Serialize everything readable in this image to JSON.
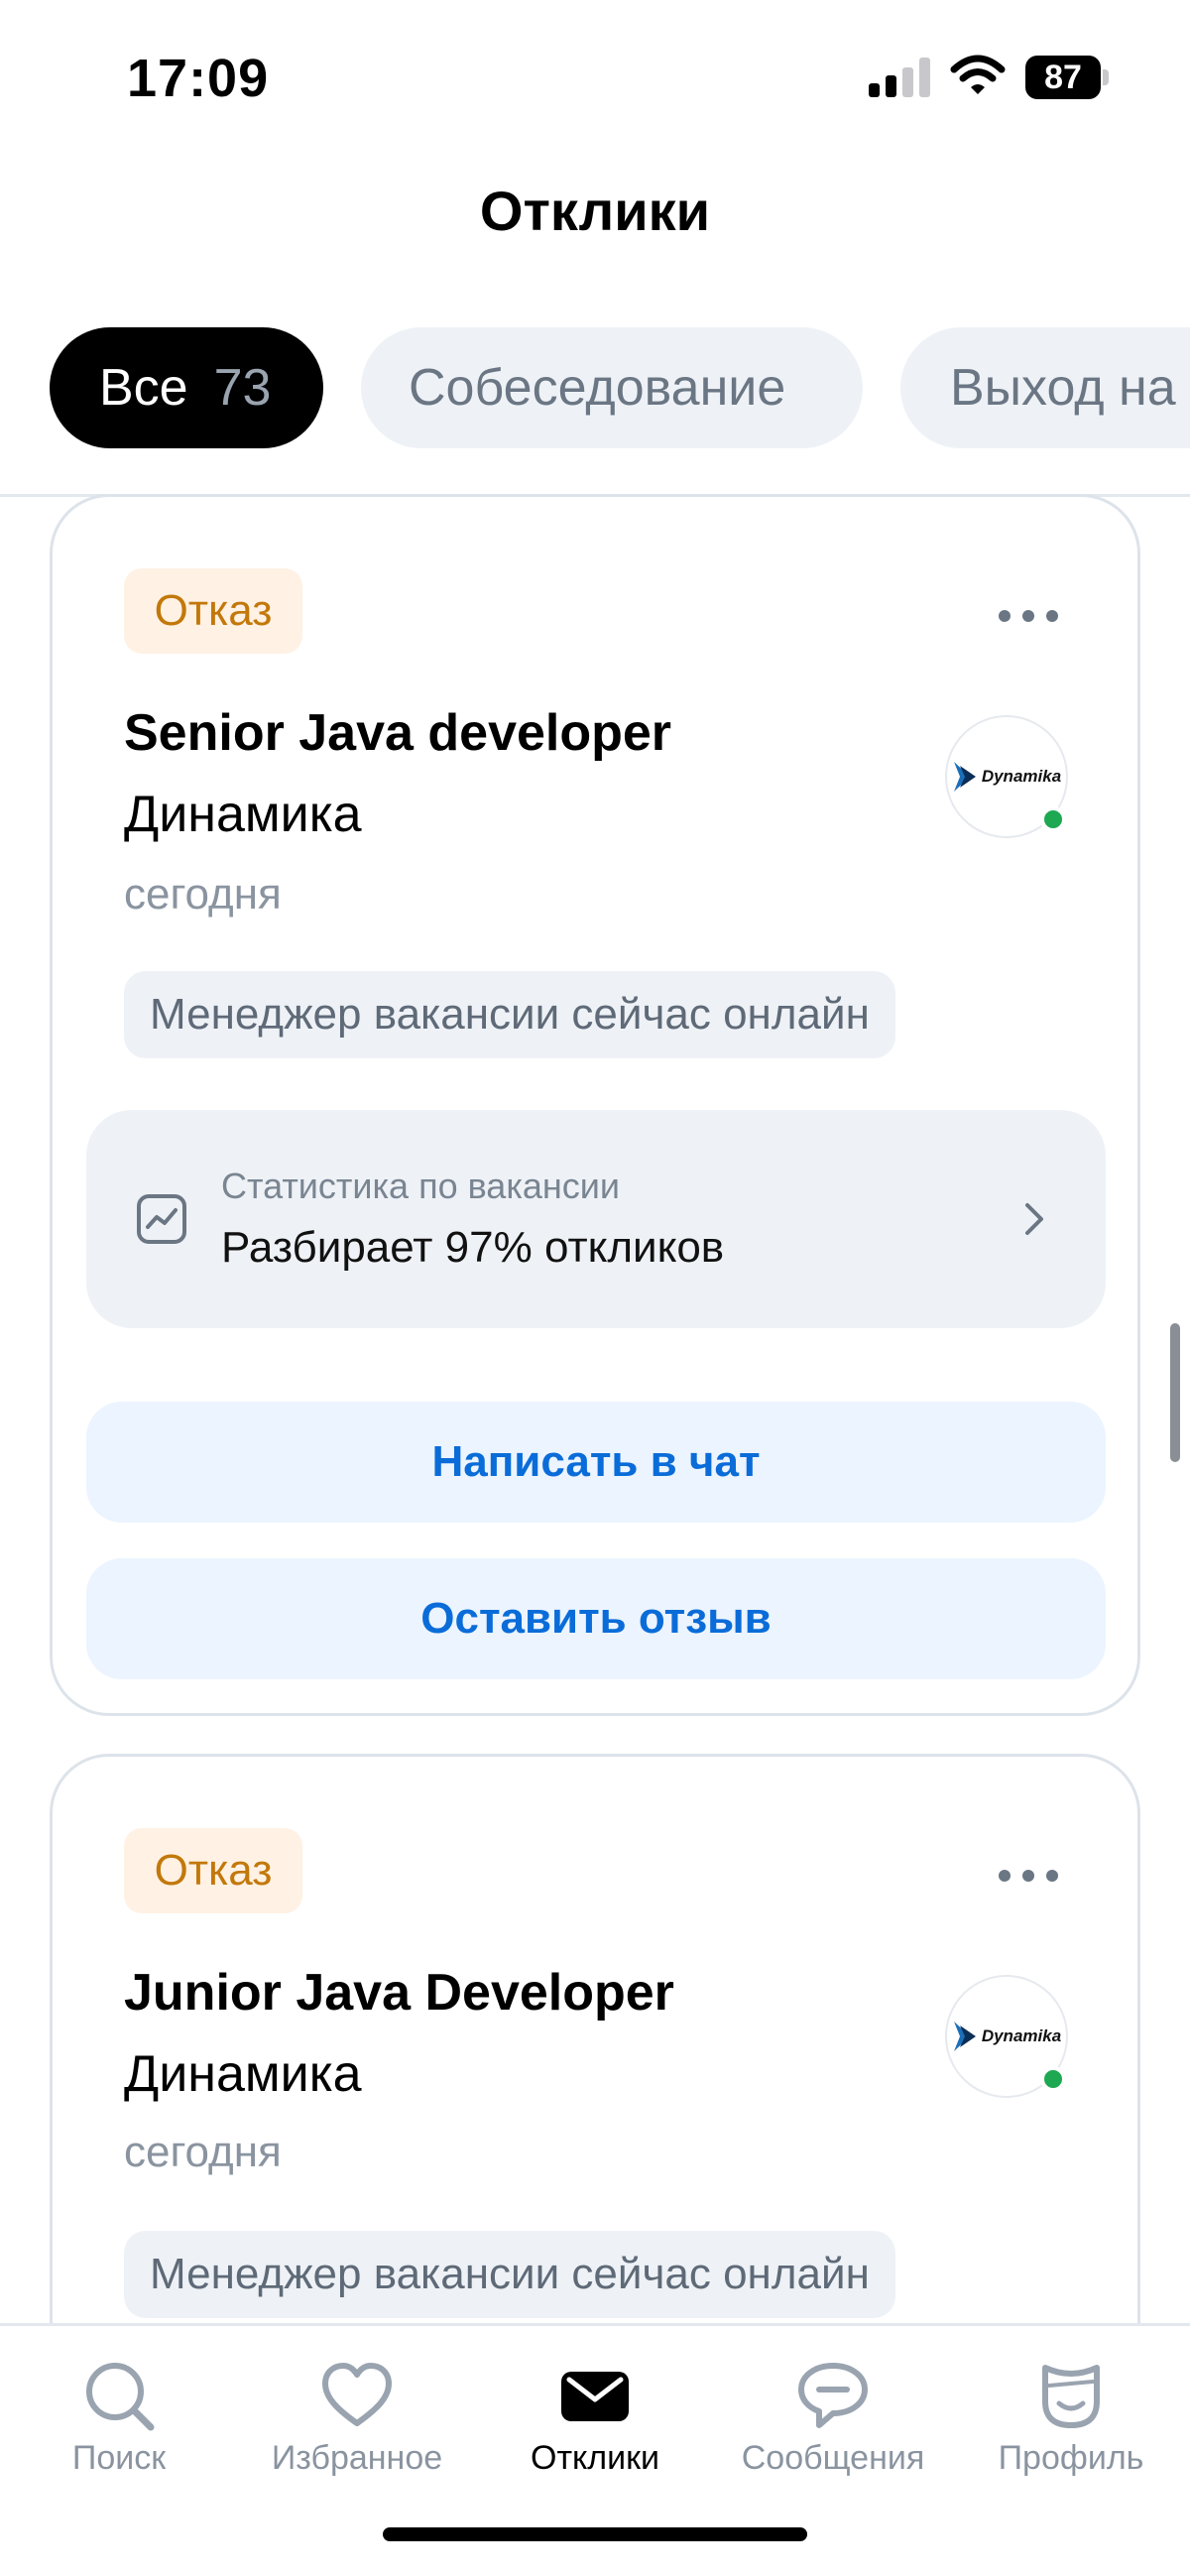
{
  "status_bar": {
    "time": "17:09",
    "battery": "87"
  },
  "header": {
    "title": "Отклики"
  },
  "tabs": [
    {
      "label": "Все",
      "count": "73",
      "active": true
    },
    {
      "label": "Собеседование"
    },
    {
      "label": "Выход на"
    }
  ],
  "cards": [
    {
      "status": "Отказ",
      "title": "Senior Java developer",
      "company": "Динамика",
      "date": "сегодня",
      "logo_text": "Dynamika",
      "manager_tag": "Менеджер вакансии сейчас онлайн",
      "stats_label": "Статистика по вакансии",
      "stats_value": "Разбирает 97% откликов",
      "chat_button": "Написать в чат",
      "review_button": "Оставить отзыв"
    },
    {
      "status": "Отказ",
      "title": "Junior Java Developer",
      "company": "Динамика",
      "date": "сегодня",
      "logo_text": "Dynamika",
      "manager_tag": "Менеджер вакансии сейчас онлайн"
    }
  ],
  "bottom_nav": [
    {
      "label": "Поиск",
      "icon": "search-icon"
    },
    {
      "label": "Избранное",
      "icon": "heart-icon"
    },
    {
      "label": "Отклики",
      "icon": "envelope-icon",
      "active": true
    },
    {
      "label": "Сообщения",
      "icon": "chat-bubble-icon"
    },
    {
      "label": "Профиль",
      "icon": "profile-icon"
    }
  ],
  "colors": {
    "accent_blue": "#0a6cd8",
    "badge_text": "#c2780a",
    "badge_bg": "#fff1e4",
    "online": "#1da851"
  }
}
